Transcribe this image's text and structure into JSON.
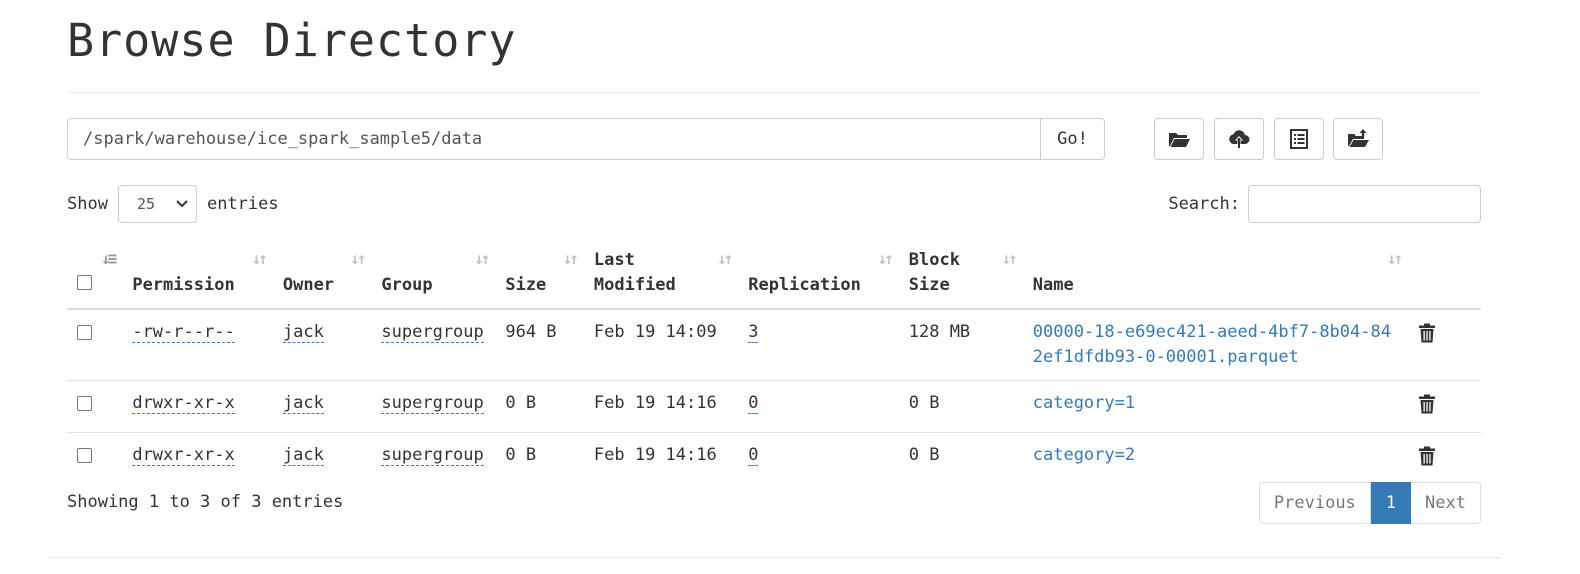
{
  "header": {
    "title": "Browse Directory"
  },
  "path_bar": {
    "path": "/spark/warehouse/ice_spark_sample5/data",
    "go_label": "Go!"
  },
  "toolbar": {
    "icons": [
      "folder-open-icon",
      "cloud-upload-icon",
      "list-alt-icon",
      "folder-upload-icon"
    ]
  },
  "controls": {
    "show_label": "Show",
    "entries_label": "entries",
    "page_length": "25",
    "search_label": "Search:",
    "search_value": ""
  },
  "table": {
    "columns": [
      "Permission",
      "Owner",
      "Group",
      "Size",
      "Last Modified",
      "Replication",
      "Block Size",
      "Name"
    ],
    "rows": [
      {
        "permission": "-rw-r--r--",
        "owner": "jack",
        "group": "supergroup",
        "size": "964 B",
        "modified": "Feb 19 14:09",
        "replication": "3",
        "block_size": "128 MB",
        "name": "00000-18-e69ec421-aeed-4bf7-8b04-842ef1dfdb93-0-00001.parquet"
      },
      {
        "permission": "drwxr-xr-x",
        "owner": "jack",
        "group": "supergroup",
        "size": "0 B",
        "modified": "Feb 19 14:16",
        "replication": "0",
        "block_size": "0 B",
        "name": "category=1"
      },
      {
        "permission": "drwxr-xr-x",
        "owner": "jack",
        "group": "supergroup",
        "size": "0 B",
        "modified": "Feb 19 14:16",
        "replication": "0",
        "block_size": "0 B",
        "name": "category=2"
      }
    ]
  },
  "footer": {
    "info": "Showing 1 to 3 of 3 entries",
    "previous_label": "Previous",
    "current_page": "1",
    "next_label": "Next"
  },
  "colors": {
    "link": "#337ab7",
    "active_page": "#337ab7",
    "border": "#dddddd"
  }
}
